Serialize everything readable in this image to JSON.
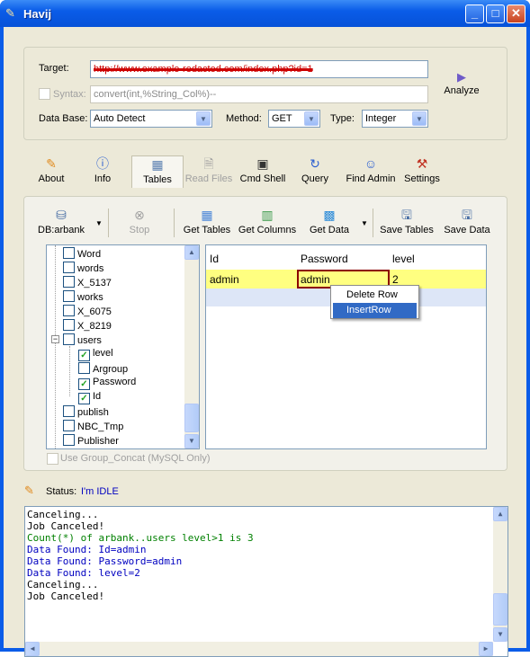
{
  "window": {
    "title": "Havij"
  },
  "target": {
    "label": "Target:",
    "value": "http://www.example-redacted.com/index.php?id=1"
  },
  "syntax": {
    "label": "Syntax:",
    "value": "convert(int,%String_Col%)--"
  },
  "database": {
    "label": "Data Base:",
    "value": "Auto Detect"
  },
  "method": {
    "label": "Method:",
    "value": "GET"
  },
  "type": {
    "label": "Type:",
    "value": "Integer"
  },
  "analyze": {
    "label": "Analyze"
  },
  "tabs": [
    {
      "label": "About",
      "icon": "carrot-icon"
    },
    {
      "label": "Info",
      "icon": "info-icon"
    },
    {
      "label": "Tables",
      "icon": "table-icon"
    },
    {
      "label": "Read Files",
      "icon": "file-icon"
    },
    {
      "label": "Cmd Shell",
      "icon": "terminal-icon"
    },
    {
      "label": "Query",
      "icon": "query-icon"
    },
    {
      "label": "Find Admin",
      "icon": "users-icon"
    },
    {
      "label": "Settings",
      "icon": "tools-icon"
    }
  ],
  "toolbar": {
    "db": "DB:arbank",
    "stop": "Stop",
    "get_tables": "Get Tables",
    "get_columns": "Get Columns",
    "get_data": "Get Data",
    "save_tables": "Save Tables",
    "save_data": "Save Data"
  },
  "tree": {
    "items": [
      {
        "label": "Word",
        "checked": false
      },
      {
        "label": "words",
        "checked": false
      },
      {
        "label": "X_5137",
        "checked": false
      },
      {
        "label": "works",
        "checked": false
      },
      {
        "label": "X_6075",
        "checked": false
      },
      {
        "label": "X_8219",
        "checked": false
      },
      {
        "label": "users",
        "checked": false
      },
      {
        "label": "level",
        "checked": true
      },
      {
        "label": "Argroup",
        "checked": false
      },
      {
        "label": "Password",
        "checked": true
      },
      {
        "label": "Id",
        "checked": true
      },
      {
        "label": "publish",
        "checked": false
      },
      {
        "label": "NBC_Tmp",
        "checked": false
      },
      {
        "label": "Publisher",
        "checked": false
      }
    ]
  },
  "grid": {
    "headers": [
      "Id",
      "Password",
      "level"
    ],
    "rows": [
      [
        "admin",
        "admin",
        "2"
      ]
    ]
  },
  "context_menu": {
    "items": [
      "Delete Row",
      "InsertRow"
    ]
  },
  "group_concat": {
    "label": "Use Group_Concat (MySQL Only)"
  },
  "status": {
    "label": "Status:",
    "value": "I'm IDLE"
  },
  "log": {
    "lines": [
      {
        "text": "Canceling...",
        "color": "#000000"
      },
      {
        "text": "Job Canceled!",
        "color": "#000000"
      },
      {
        "text": "Count(*) of arbank..users level>1 is 3",
        "color": "#008000"
      },
      {
        "text": "Data Found: Id=admin",
        "color": "#0000c0"
      },
      {
        "text": "Data Found: Password=admin",
        "color": "#0000c0"
      },
      {
        "text": "Data Found: level=2",
        "color": "#0000c0"
      },
      {
        "text": "Canceling...",
        "color": "#000000"
      },
      {
        "text": "Job Canceled!",
        "color": "#000000"
      }
    ]
  },
  "colors": {
    "titlebar": "#0a5ce8",
    "selected_row": "#ffff80",
    "highlight": "#316ac5",
    "cell_border": "#8b0000"
  }
}
